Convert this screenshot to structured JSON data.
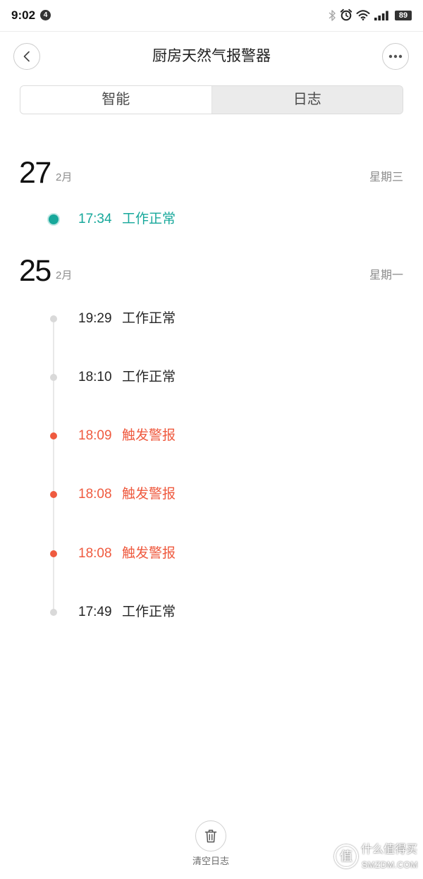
{
  "status_bar": {
    "time": "9:02",
    "notification_count": "4",
    "battery": "89",
    "icons": [
      "bluetooth-icon",
      "alarm-icon",
      "wifi-icon",
      "signal-icon",
      "battery-icon"
    ]
  },
  "header": {
    "title": "厨房天然气报警器",
    "back_icon": "chevron-left-icon",
    "more_icon": "more-dots-icon"
  },
  "tabs": [
    {
      "label": "智能",
      "selected": false
    },
    {
      "label": "日志",
      "selected": true
    }
  ],
  "log_groups": [
    {
      "day": "27",
      "month": "2月",
      "weekday": "星期三",
      "entries": [
        {
          "time": "17:34",
          "status": "工作正常",
          "text_color": "#17a89b",
          "dot_color": "#17a89b"
        }
      ]
    },
    {
      "day": "25",
      "month": "2月",
      "weekday": "星期一",
      "entries": [
        {
          "time": "19:29",
          "status": "工作正常",
          "text_color": "#262626",
          "dot_color": "#d9d9d9"
        },
        {
          "time": "18:10",
          "status": "工作正常",
          "text_color": "#262626",
          "dot_color": "#d9d9d9"
        },
        {
          "time": "18:09",
          "status": "触发警报",
          "text_color": "#ef5a3f",
          "dot_color": "#ef5a3f"
        },
        {
          "time": "18:08",
          "status": "触发警报",
          "text_color": "#ef5a3f",
          "dot_color": "#ef5a3f"
        },
        {
          "time": "18:08",
          "status": "触发警报",
          "text_color": "#ef5a3f",
          "dot_color": "#ef5a3f"
        },
        {
          "time": "17:49",
          "status": "工作正常",
          "text_color": "#262626",
          "dot_color": "#d9d9d9"
        }
      ]
    }
  ],
  "footer": {
    "clear_label": "清空日志",
    "clear_icon": "trash-icon"
  },
  "watermark": {
    "logo_glyph": "值",
    "name": "什么值得买",
    "site": "SMZDM.COM"
  },
  "colors": {
    "timeline": "#e8e8e8",
    "muted_text": "#8c8c8c",
    "tab_selected_bg": "#ebebeb"
  }
}
